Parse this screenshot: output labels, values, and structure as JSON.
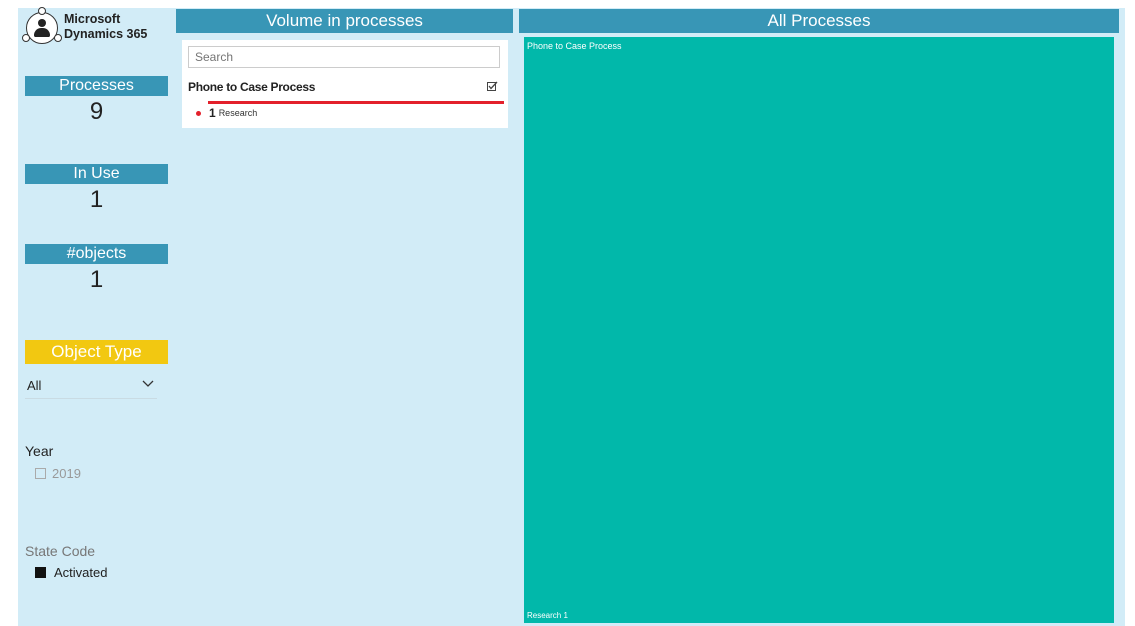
{
  "logo": {
    "line1": "Microsoft",
    "line2": "Dynamics 365"
  },
  "kpis": [
    {
      "label": "Processes",
      "value": "9"
    },
    {
      "label": "In Use",
      "value": "1"
    },
    {
      "label": "#objects",
      "value": "1"
    }
  ],
  "object_type": {
    "label": "Object Type",
    "selected": "All"
  },
  "year_slicer": {
    "title": "Year",
    "options": [
      "2019"
    ]
  },
  "state_slicer": {
    "title": "State Code",
    "options": [
      "Activated"
    ]
  },
  "volume_panel": {
    "title": "Volume in processes",
    "search_placeholder": "Search",
    "process_name": "Phone to Case Process",
    "sub_count": "1",
    "sub_label": "Research",
    "bar_fraction": 1.0
  },
  "treemap_panel": {
    "title": "All Processes",
    "top_label": "Phone to Case Process",
    "bottom_label": "Research 1",
    "color": "#01b8aa"
  },
  "colors": {
    "header": "#3896b6",
    "accent": "#f2c811",
    "background": "#d2ecf7",
    "highlight": "#e3202b"
  },
  "icons": [
    "dynamics-logo-icon",
    "chevron-down-icon",
    "checkbox-checked-icon"
  ]
}
